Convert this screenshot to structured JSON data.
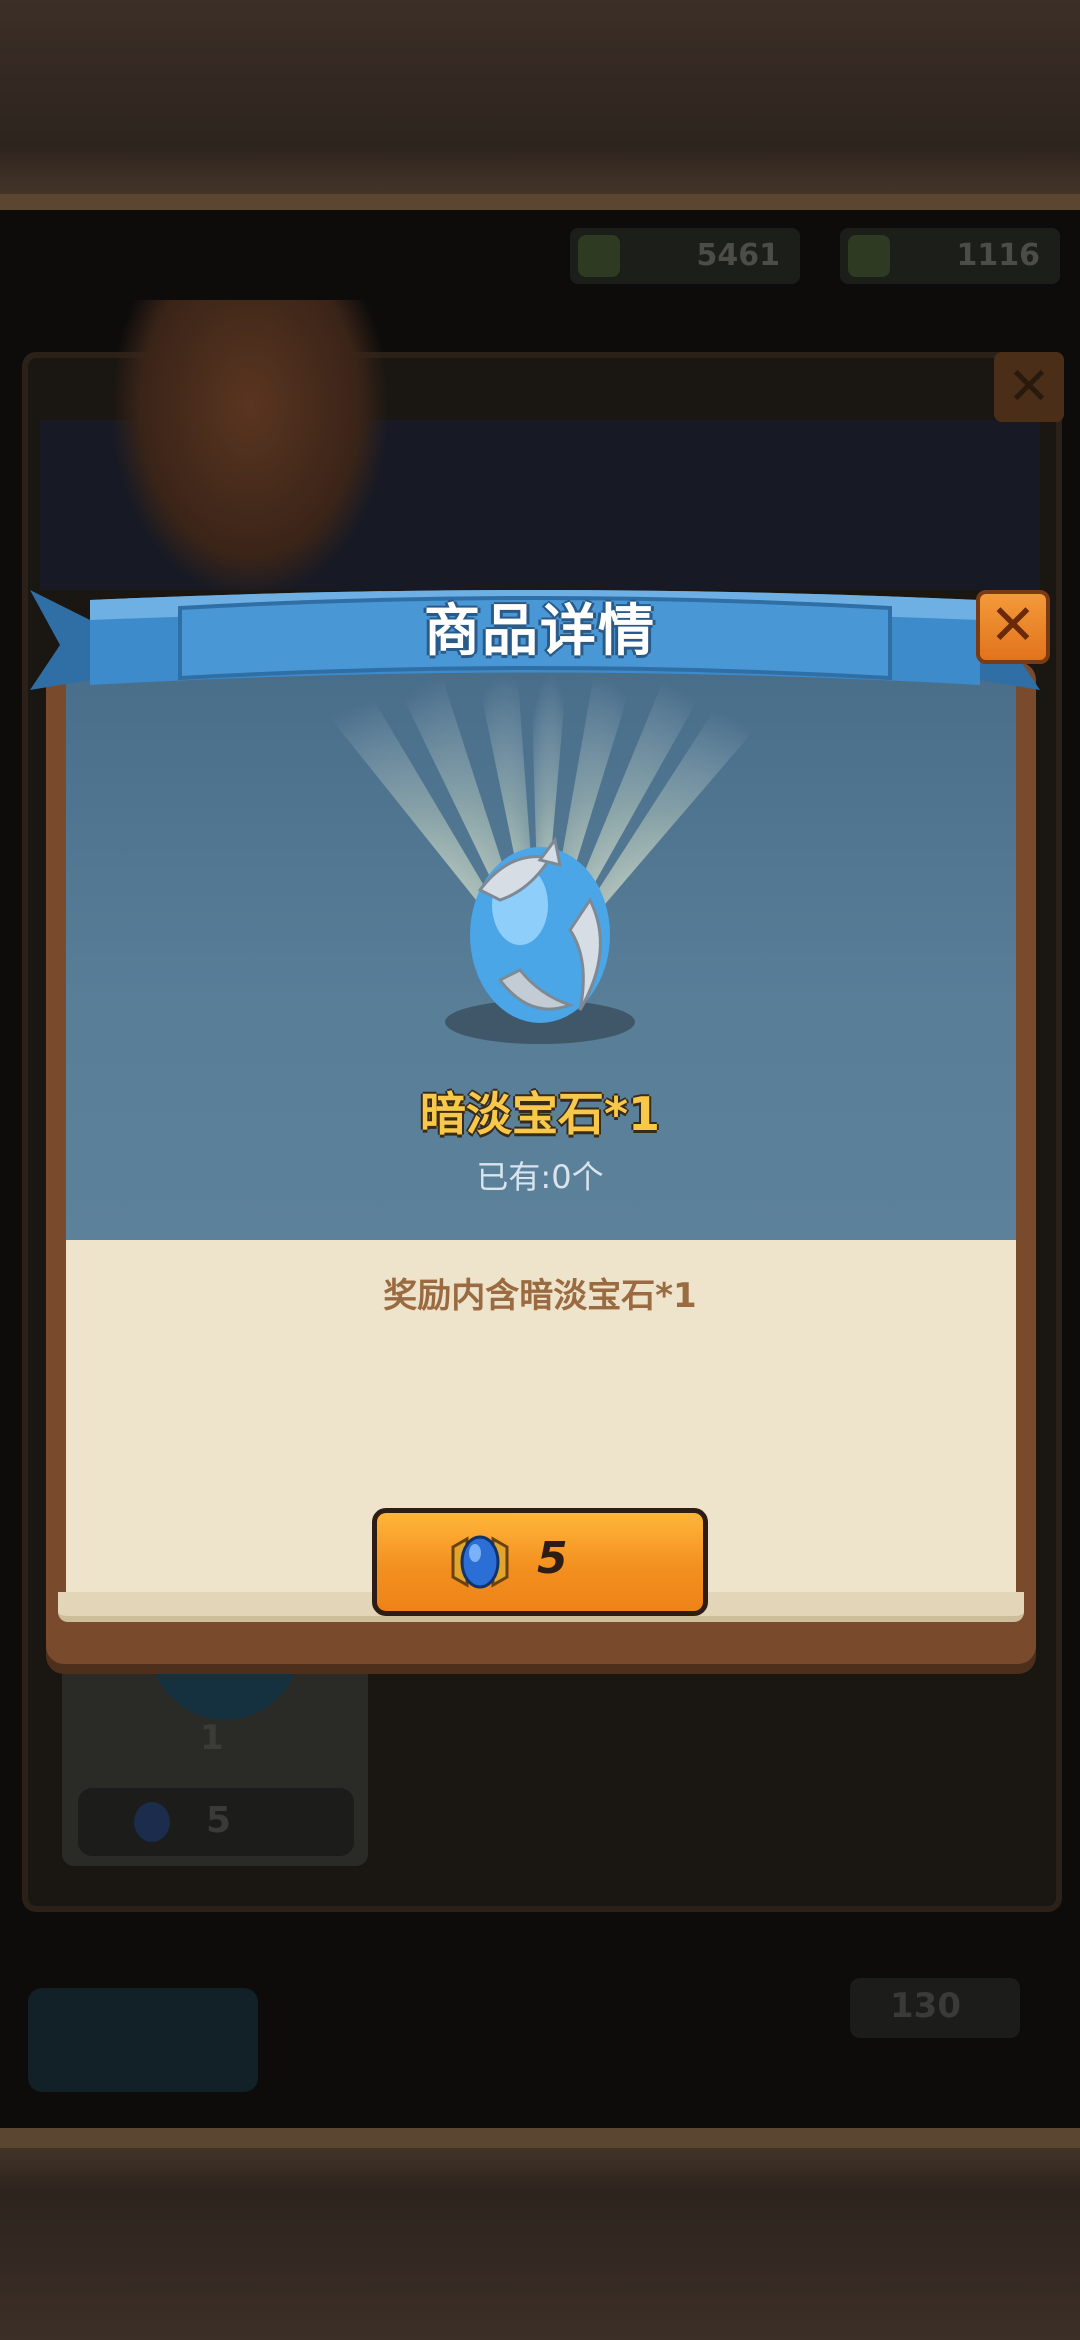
{
  "background": {
    "resource_1_value": "5461",
    "resource_2_value": "1116",
    "item_card_qty": "1",
    "item_card_price": "5",
    "refresh_cost": "130"
  },
  "modal": {
    "title": "商品详情",
    "close_symbol": "✕",
    "item_name": "暗淡宝石*1",
    "owned_text": "已有:0个",
    "description": "奖励内含暗淡宝石*1",
    "buy_price": "5",
    "price_icon": "blue-gem-badge-icon",
    "item_icon": "dim-gem-icon"
  },
  "colors": {
    "ribbon_blue": "#3e8bcc",
    "button_orange": "#f39020",
    "item_name_gold": "#f7c84a",
    "close_orange": "#e2731c"
  }
}
